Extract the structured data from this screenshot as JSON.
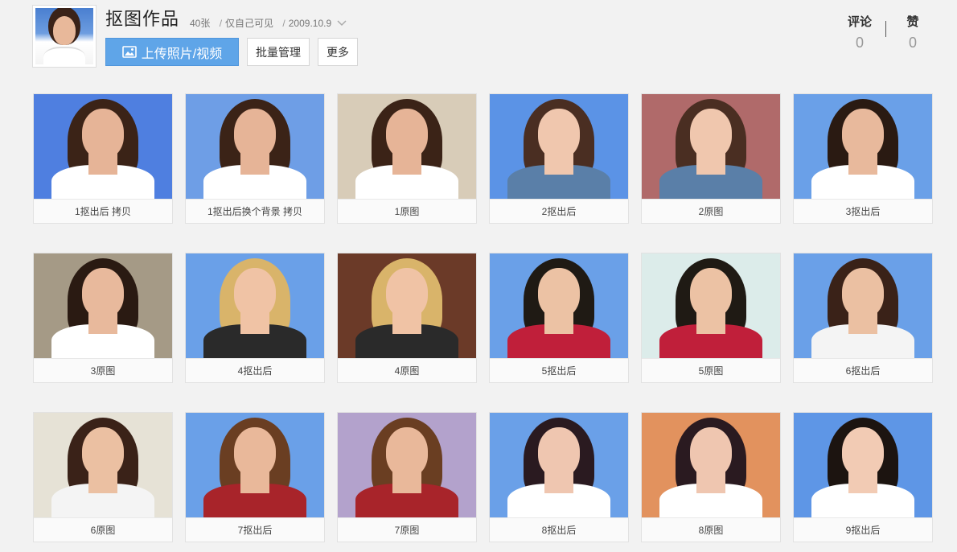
{
  "album": {
    "title": "抠图作品",
    "count": "40张",
    "visibility": "仅自己可见",
    "date": "2009.10.9"
  },
  "buttons": {
    "upload": "上传照片/视频",
    "batch": "批量管理",
    "more": "更多"
  },
  "stats": {
    "comment_label": "评论",
    "comment_value": "0",
    "like_label": "赞",
    "like_value": "0"
  },
  "photos": [
    {
      "caption": "1抠出后 拷贝",
      "bg": "#4f7fe0",
      "hair": "#3b2317",
      "skin": "#e6b497",
      "top": "#ffffff"
    },
    {
      "caption": "1抠出后换个背景 拷贝",
      "bg": "#6e9ee6",
      "hair": "#3b2317",
      "skin": "#e6b497",
      "top": "#ffffff"
    },
    {
      "caption": "1原图",
      "bg": "#d8ccb8",
      "hair": "#3b2317",
      "skin": "#e6b497",
      "top": "#ffffff"
    },
    {
      "caption": "2抠出后",
      "bg": "#5b93e6",
      "hair": "#4a2e22",
      "skin": "#f0c7ae",
      "top": "#5a7fa8"
    },
    {
      "caption": "2原图",
      "bg": "#b06a6a",
      "hair": "#4a2e22",
      "skin": "#f0c7ae",
      "top": "#5a7fa8"
    },
    {
      "caption": "3抠出后",
      "bg": "#6aa0e8",
      "hair": "#2a1a12",
      "skin": "#e8b99c",
      "top": "#ffffff"
    },
    {
      "caption": "3原图",
      "bg": "#a59a86",
      "hair": "#2a1a12",
      "skin": "#e8b99c",
      "top": "#ffffff"
    },
    {
      "caption": "4抠出后",
      "bg": "#6aa0e8",
      "hair": "#d9b46a",
      "skin": "#f0c3a5",
      "top": "#2a2a2a"
    },
    {
      "caption": "4原图",
      "bg": "#6b3a28",
      "hair": "#d9b46a",
      "skin": "#f0c3a5",
      "top": "#2a2a2a"
    },
    {
      "caption": "5抠出后",
      "bg": "#6aa0e8",
      "hair": "#1f1a14",
      "skin": "#ecc2a4",
      "top": "#c01f3a"
    },
    {
      "caption": "5原图",
      "bg": "#dcecea",
      "hair": "#1f1a14",
      "skin": "#ecc2a4",
      "top": "#c01f3a"
    },
    {
      "caption": "6抠出后",
      "bg": "#6aa0e8",
      "hair": "#3a2218",
      "skin": "#ebc0a2",
      "top": "#f4f4f4"
    },
    {
      "caption": "6原图",
      "bg": "#e6e2d6",
      "hair": "#3a2218",
      "skin": "#ebc0a2",
      "top": "#f4f4f4"
    },
    {
      "caption": "7抠出后",
      "bg": "#6aa0e8",
      "hair": "#6a3e22",
      "skin": "#e9b89a",
      "top": "#a8242a"
    },
    {
      "caption": "7原图",
      "bg": "#b3a2cc",
      "hair": "#6a3e22",
      "skin": "#e9b89a",
      "top": "#a8242a"
    },
    {
      "caption": "8抠出后",
      "bg": "#6aa0e8",
      "hair": "#2a1a20",
      "skin": "#efc6b0",
      "top": "#ffffff"
    },
    {
      "caption": "8原图",
      "bg": "#e2925e",
      "hair": "#2a1a20",
      "skin": "#efc6b0",
      "top": "#ffffff"
    },
    {
      "caption": "9抠出后",
      "bg": "#5e96e6",
      "hair": "#1c1410",
      "skin": "#f2cbb4",
      "top": "#ffffff"
    }
  ]
}
